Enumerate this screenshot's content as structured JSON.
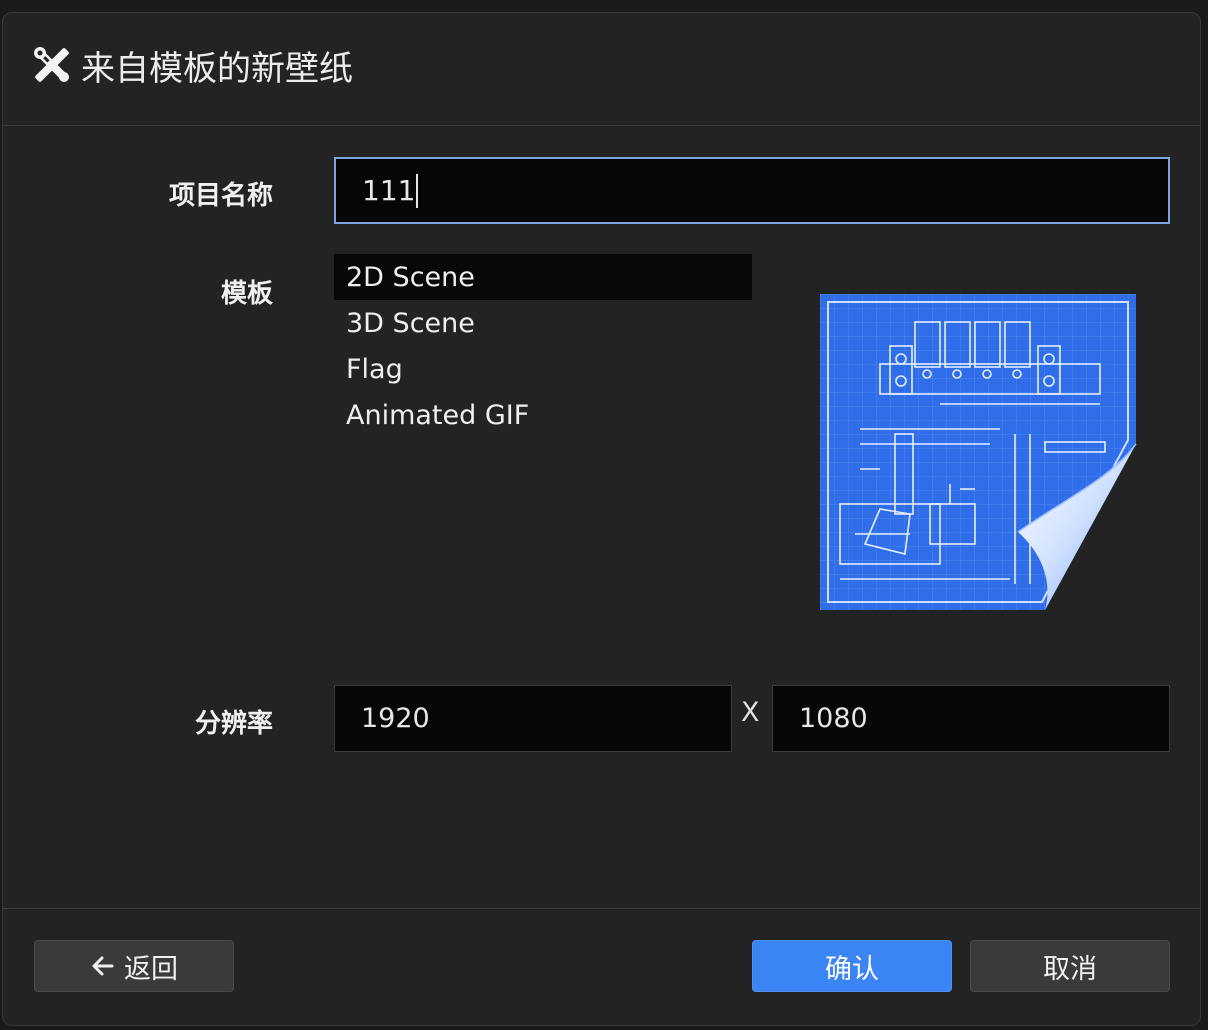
{
  "dialog": {
    "title": "来自模板的新壁纸",
    "title_icon": "tools-icon"
  },
  "form": {
    "project_name_label": "项目名称",
    "project_name_value": "111",
    "template_label": "模板",
    "templates": [
      {
        "label": "2D Scene",
        "selected": true
      },
      {
        "label": "3D Scene",
        "selected": false
      },
      {
        "label": "Flag",
        "selected": false
      },
      {
        "label": "Animated GIF",
        "selected": false
      }
    ],
    "preview_icon": "blueprint-document-icon",
    "resolution_label": "分辨率",
    "resolution_width": "1920",
    "resolution_separator": "X",
    "resolution_height": "1080"
  },
  "footer": {
    "back_label": "返回",
    "back_icon": "arrow-left-icon",
    "confirm_label": "确认",
    "cancel_label": "取消"
  },
  "colors": {
    "accent": "#3b84f3",
    "input_focus_border": "#7fa3e0",
    "dialog_bg": "#232323",
    "input_bg": "#060606",
    "blueprint": "#2f6ee8"
  }
}
